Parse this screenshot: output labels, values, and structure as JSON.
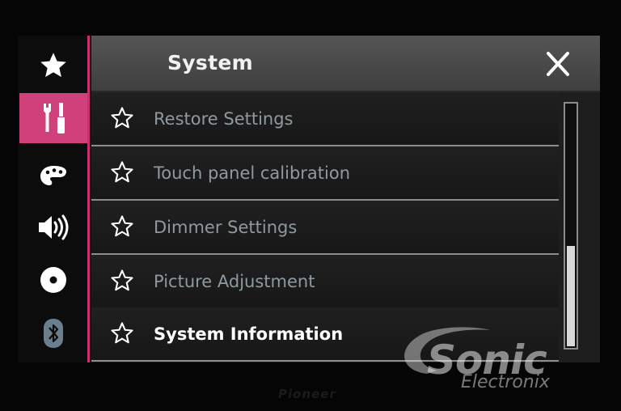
{
  "header": {
    "title": "System"
  },
  "sidebar": {
    "items": [
      {
        "icon": "star-icon",
        "active": false
      },
      {
        "icon": "tools-icon",
        "active": true
      },
      {
        "icon": "palette-icon",
        "active": false
      },
      {
        "icon": "speaker-icon",
        "active": false
      },
      {
        "icon": "disc-icon",
        "active": false
      },
      {
        "icon": "bluetooth-icon",
        "active": false
      }
    ]
  },
  "menu": {
    "items": [
      {
        "label": "Restore Settings"
      },
      {
        "label": "Touch panel calibration"
      },
      {
        "label": "Dimmer Settings"
      },
      {
        "label": "Picture Adjustment"
      },
      {
        "label": "System Information",
        "highlighted": true
      }
    ]
  },
  "scrollbar": {
    "position": 1.0
  },
  "watermark": {
    "line1": "Sonic",
    "line2": "Electronix"
  },
  "device_brand": "Pioneer",
  "colors": {
    "accent": "#d0407a",
    "header": "#4a4a4a",
    "text_inactive": "#8e9aa0"
  }
}
